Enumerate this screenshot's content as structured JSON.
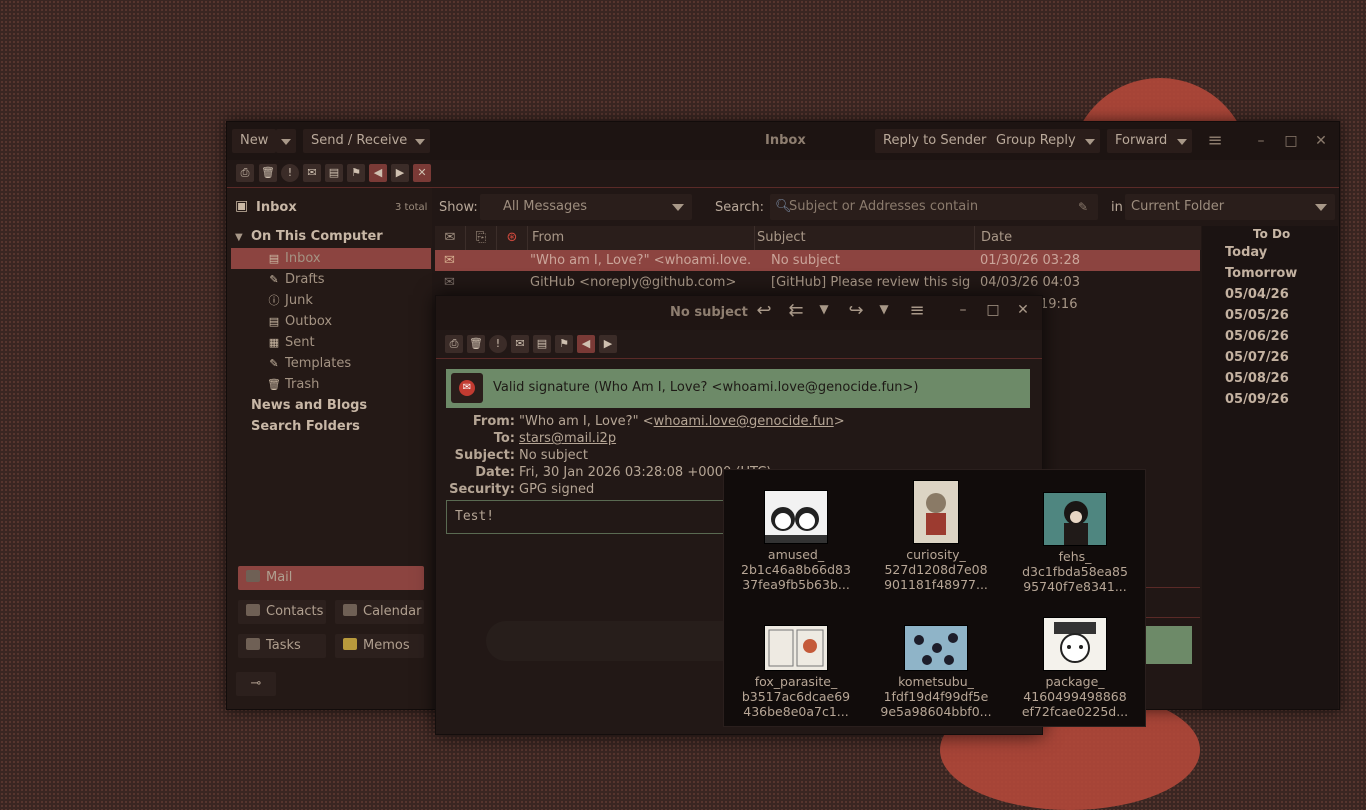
{
  "colors": {
    "accent": "#8c4440",
    "signature_bg": "#6d8a68",
    "window_bg": "#211715"
  },
  "toolbar": {
    "new_label": "New",
    "send_receive_label": "Send / Receive",
    "window_title": "Inbox",
    "reply_label": "Reply to Sender",
    "group_reply_label": "Group Reply",
    "forward_label": "Forward"
  },
  "sidebar": {
    "header_title": "Inbox",
    "header_count": "3 total",
    "section": "On This Computer",
    "folders": [
      {
        "label": "Inbox",
        "icon": "inbox-icon"
      },
      {
        "label": "Drafts",
        "icon": "drafts-icon"
      },
      {
        "label": "Junk",
        "icon": "junk-icon"
      },
      {
        "label": "Outbox",
        "icon": "outbox-icon"
      },
      {
        "label": "Sent",
        "icon": "sent-icon"
      },
      {
        "label": "Templates",
        "icon": "templates-icon"
      },
      {
        "label": "Trash",
        "icon": "trash-icon"
      }
    ],
    "news": "News and Blogs",
    "search_folders": "Search Folders",
    "switcher": {
      "mail": "Mail",
      "contacts": "Contacts",
      "calendar": "Calendar",
      "tasks": "Tasks",
      "memos": "Memos"
    }
  },
  "filter": {
    "show_label": "Show:",
    "show_value": "All Messages",
    "search_label": "Search:",
    "search_placeholder": "Subject or Addresses contain",
    "in_label": "in",
    "scope_value": "Current Folder"
  },
  "columns": {
    "from": "From",
    "subject": "Subject",
    "date": "Date"
  },
  "messages": [
    {
      "from": "\"Who am I, Love?\" <whoami.love...",
      "subject": "No subject",
      "date": "01/30/26 03:28"
    },
    {
      "from": "GitHub <noreply@github.com>",
      "subject": "[GitHub] Please review this sig...",
      "date": "04/03/26 04:03"
    },
    {
      "date_partial": "19:16"
    }
  ],
  "todo": {
    "title": "To Do",
    "items": [
      "Today",
      "Tomorrow",
      "05/04/26",
      "05/05/26",
      "05/06/26",
      "05/07/26",
      "05/08/26",
      "05/09/26"
    ]
  },
  "message_window": {
    "title": "No subject",
    "signature": "Valid signature (Who Am I, Love? <whoami.love@genocide.fun>)",
    "labels": {
      "from": "From:",
      "to": "To:",
      "subject": "Subject:",
      "date": "Date:",
      "security": "Security:"
    },
    "from_name": "\"Who am I, Love?\" <",
    "from_email": "whoami.love@genocide.fun",
    "from_tail": ">",
    "to": "stars@mail.i2p",
    "subject": "No subject",
    "date": "Fri, 30 Jan 2026 03:28:08 +0000 (UTC)",
    "security": "GPG signed",
    "body": "Test!"
  },
  "attachments": [
    {
      "l1": "amused_",
      "l2": "2b1c46a8b66d83",
      "l3": "37fea9fb5b63b..."
    },
    {
      "l1": "curiosity_",
      "l2": "527d1208d7e08",
      "l3": "901181f48977..."
    },
    {
      "l1": "fehs_",
      "l2": "d3c1fbda58ea85",
      "l3": "95740f7e8341..."
    },
    {
      "l1": "fox_parasite_",
      "l2": "b3517ac6dcae69",
      "l3": "436be8e0a7c1..."
    },
    {
      "l1": "kometsubu_",
      "l2": "1fdf19d4f99df5e",
      "l3": "9e5a98604bbf0..."
    },
    {
      "l1": "package_",
      "l2": "4160499498868",
      "l3": "ef72fcae0225d..."
    }
  ]
}
